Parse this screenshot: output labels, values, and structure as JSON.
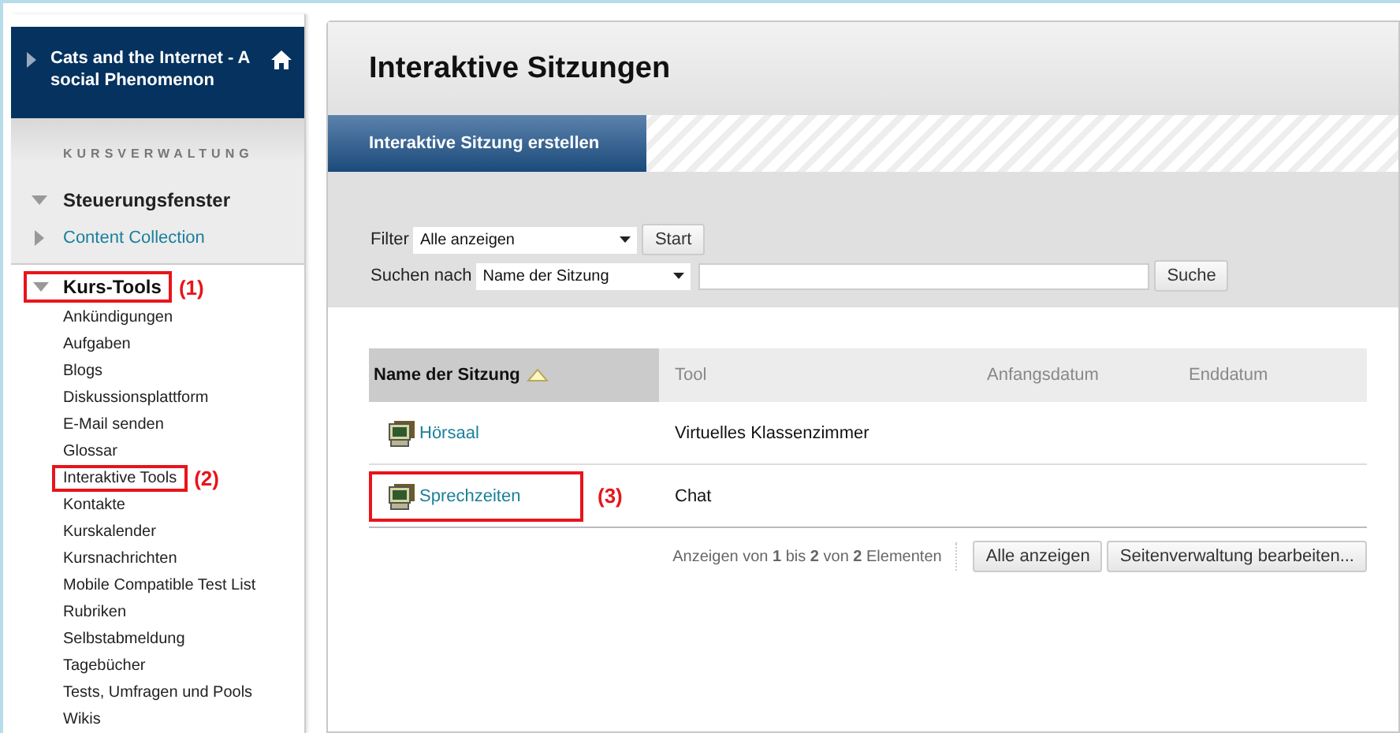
{
  "course": {
    "title": "Cats and the Internet - A social Phenomenon"
  },
  "sidebar": {
    "section": "KURSVERWALTUNG",
    "groups": [
      {
        "label": "Steuerungsfenster",
        "expanded": true,
        "kind": "heading"
      },
      {
        "label": "Content Collection",
        "expanded": false,
        "kind": "link"
      }
    ],
    "tools": {
      "label": "Kurs-Tools",
      "expanded": true,
      "callout": "(1)",
      "items": [
        {
          "label": "Ankündigungen"
        },
        {
          "label": "Aufgaben"
        },
        {
          "label": "Blogs"
        },
        {
          "label": "Diskussionsplattform"
        },
        {
          "label": "E-Mail senden"
        },
        {
          "label": "Glossar"
        },
        {
          "label": "Interaktive Tools",
          "callout": "(2)"
        },
        {
          "label": "Kontakte"
        },
        {
          "label": "Kurskalender"
        },
        {
          "label": "Kursnachrichten"
        },
        {
          "label": "Mobile Compatible Test List"
        },
        {
          "label": "Rubriken"
        },
        {
          "label": "Selbstabmeldung"
        },
        {
          "label": "Tagebücher"
        },
        {
          "label": "Tests, Umfragen und Pools"
        },
        {
          "label": "Wikis"
        }
      ]
    }
  },
  "page": {
    "title": "Interaktive Sitzungen",
    "action": "Interaktive Sitzung erstellen",
    "filter": {
      "label": "Filter",
      "value": "Alle anzeigen",
      "button": "Start"
    },
    "search": {
      "label": "Suchen nach",
      "field": "Name der Sitzung",
      "button": "Suche"
    }
  },
  "table": {
    "columns": [
      {
        "label": "Name der Sitzung",
        "sorted": true
      },
      {
        "label": "Tool",
        "sorted": false
      },
      {
        "label": "Anfangsdatum",
        "sorted": false
      },
      {
        "label": "Enddatum",
        "sorted": false
      }
    ],
    "rows": [
      {
        "name": "Hörsaal",
        "tool": "Virtuelles Klassenzimmer"
      },
      {
        "name": "Sprechzeiten",
        "tool": "Chat",
        "callout": "(3)"
      }
    ],
    "footer": {
      "summary": "Anzeigen von **1** bis **2** von **2** Elementen",
      "buttons": [
        "Alle anzeigen",
        "Seitenverwaltung bearbeiten..."
      ]
    }
  }
}
